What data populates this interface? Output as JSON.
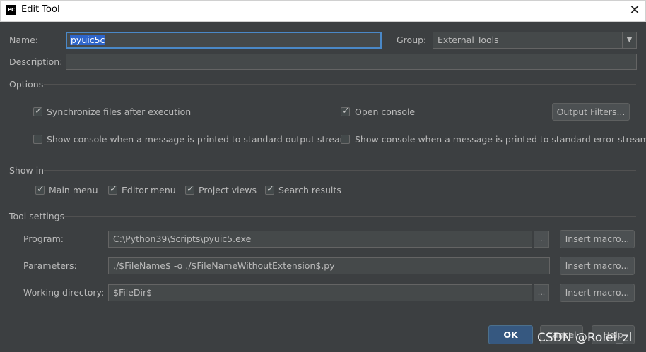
{
  "window": {
    "title": "Edit Tool",
    "app_icon": "PC",
    "close_icon": "close-icon"
  },
  "form": {
    "name_label": "Name:",
    "name_value": "pyuic5c",
    "group_label": "Group:",
    "group_value": "External Tools",
    "description_label": "Description:",
    "description_value": ""
  },
  "options": {
    "heading": "Options",
    "sync_files": {
      "label": "Synchronize files after execution",
      "checked": true
    },
    "open_console": {
      "label": "Open console",
      "checked": true
    },
    "output_filters_label": "Output Filters...",
    "show_console_stdout": {
      "label": "Show console when a message is printed to standard output stream",
      "checked": false
    },
    "show_console_stderr": {
      "label": "Show console when a message is printed to standard error stream",
      "checked": false
    }
  },
  "show_in": {
    "heading": "Show in",
    "main_menu": {
      "label": "Main menu",
      "checked": true
    },
    "editor_menu": {
      "label": "Editor menu",
      "checked": true
    },
    "project_views": {
      "label": "Project views",
      "checked": true
    },
    "search_results": {
      "label": "Search results",
      "checked": true
    }
  },
  "tool_settings": {
    "heading": "Tool settings",
    "program_label": "Program:",
    "program_value": "C:\\Python39\\Scripts\\pyuic5.exe",
    "parameters_label": "Parameters:",
    "parameters_value": "./$FileName$ -o ./$FileNameWithoutExtension$.py",
    "workdir_label": "Working directory:",
    "workdir_value": "$FileDir$",
    "browse_label": "...",
    "insert_macro_label": "Insert macro..."
  },
  "footer": {
    "ok_label": "OK",
    "cancel_label": "Cancel",
    "help_label": "Help"
  },
  "watermark": "CSDN @Rolei_zl",
  "colors": {
    "background": "#3c3f41",
    "field": "#45494a",
    "focus": "#4a88c7",
    "selection": "#2f65ca",
    "default_button": "#365880"
  }
}
